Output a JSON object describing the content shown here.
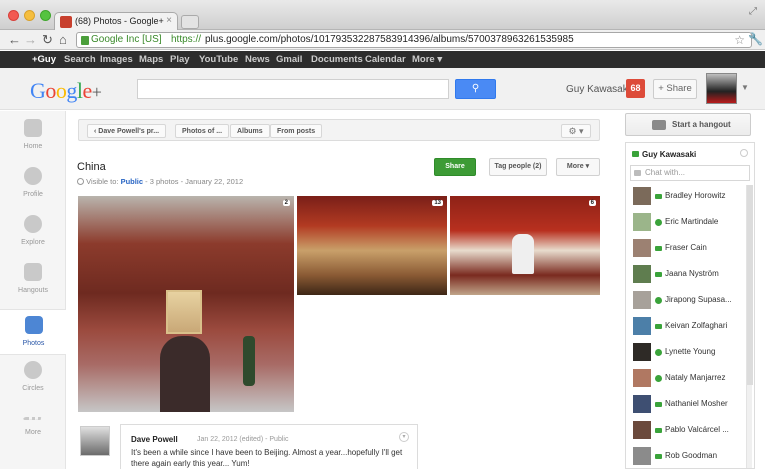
{
  "browser": {
    "tab_title": "(68) Photos - Google+",
    "secure_label": "Google Inc [US]",
    "url_scheme": "https://",
    "url_rest": "plus.google.com/photos/101793532287583914396/albums/5700378963261535985"
  },
  "gbar": {
    "items": [
      "+Guy",
      "Search",
      "Images",
      "Maps",
      "Play",
      "YouTube",
      "News",
      "Gmail",
      "Documents",
      "Calendar",
      "More ▾"
    ]
  },
  "header": {
    "logo": "Google+",
    "search_placeholder": "",
    "search_button": "🔍",
    "user_name": "Guy Kawasaki",
    "notification_count": "68",
    "share_label": "+ Share"
  },
  "leftnav": {
    "items": [
      {
        "label": "Home"
      },
      {
        "label": "Profile"
      },
      {
        "label": "Explore"
      },
      {
        "label": "Hangouts"
      },
      {
        "label": "Photos"
      },
      {
        "label": "Circles"
      },
      {
        "label": "More"
      }
    ]
  },
  "breadcrumbs": {
    "back": "‹ Dave Powell's pr...",
    "photos_of": "Photos of ...",
    "albums": "Albums",
    "from_posts": "From posts",
    "gear": "⚙ ▾"
  },
  "album": {
    "title": "China",
    "visible_to_prefix": "Visible to: ",
    "visibility": "Public",
    "meta_rest": " - 3 photos - January 22, 2012",
    "share_button": "Share",
    "tag_button": "Tag people (2)",
    "more_button": "More ▾",
    "photos": [
      {
        "count": "2"
      },
      {
        "count": "13"
      },
      {
        "count": "6"
      }
    ]
  },
  "comment": {
    "author": "Dave Powell",
    "meta": "Jan 22, 2012 (edited) - Public",
    "text": "It's been a while since I have been to Beijing. Almost a year...hopefully I'll get there again early this year... Yum!"
  },
  "sidebar": {
    "hangout_button": "Start a hangout",
    "chat_user": "Guy Kawasaki",
    "chat_placeholder": "Chat with...",
    "contacts": [
      {
        "name": "Bradley Horowitz",
        "status": "video",
        "color": "#7b6a5a"
      },
      {
        "name": "Eric Martindale",
        "status": "online",
        "color": "#9bb58a"
      },
      {
        "name": "Fraser Cain",
        "status": "video",
        "color": "#9c8172"
      },
      {
        "name": "Jaana Nyström",
        "status": "video",
        "color": "#5f7d4f"
      },
      {
        "name": "Jirapong Supasa...",
        "status": "online",
        "color": "#a7a19a"
      },
      {
        "name": "Keivan Zolfaghari",
        "status": "video",
        "color": "#4c7fa8"
      },
      {
        "name": "Lynette Young",
        "status": "online",
        "color": "#2e2a26"
      },
      {
        "name": "Nataly Manjarrez",
        "status": "online",
        "color": "#b07862"
      },
      {
        "name": "Nathaniel Mosher",
        "status": "video",
        "color": "#3e4f72"
      },
      {
        "name": "Pablo Valcárcel ...",
        "status": "video",
        "color": "#6b4a3c"
      },
      {
        "name": "Rob Goodman",
        "status": "video",
        "color": "#8b8b8b"
      }
    ]
  }
}
